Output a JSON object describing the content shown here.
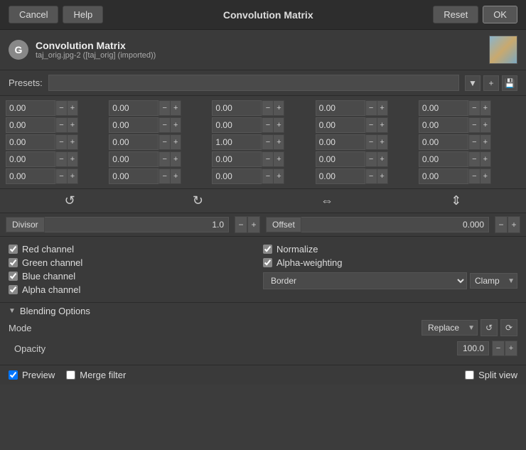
{
  "titlebar": {
    "cancel_label": "Cancel",
    "help_label": "Help",
    "title": "Convolution Matrix",
    "reset_label": "Reset",
    "ok_label": "OK"
  },
  "plugin": {
    "icon_letter": "G",
    "title": "Convolution Matrix",
    "subtitle": "taj_orig.jpg-2 ([taj_orig] (imported))"
  },
  "presets": {
    "label": "Presets:",
    "add_icon": "+",
    "remove_icon": "🗑"
  },
  "matrix": {
    "rows": [
      [
        "0.00",
        "0.00",
        "0.00",
        "0.00",
        "0.00"
      ],
      [
        "0.00",
        "0.00",
        "0.00",
        "0.00",
        "0.00"
      ],
      [
        "0.00",
        "0.00",
        "1.00",
        "0.00",
        "0.00"
      ],
      [
        "0.00",
        "0.00",
        "0.00",
        "0.00",
        "0.00"
      ],
      [
        "0.00",
        "0.00",
        "0.00",
        "0.00",
        "0.00"
      ]
    ]
  },
  "divisor": {
    "label": "Divisor",
    "value": "1.0"
  },
  "offset": {
    "label": "Offset",
    "value": "0.000"
  },
  "options": {
    "red_channel": "Red channel",
    "green_channel": "Green channel",
    "blue_channel": "Blue channel",
    "alpha_channel": "Alpha channel",
    "normalize": "Normalize",
    "alpha_weighting": "Alpha-weighting",
    "border_label": "Border",
    "clamp_label": "Clamp"
  },
  "blending": {
    "title": "Blending Options",
    "mode_label": "Mode",
    "mode_value": "Replace",
    "opacity_label": "Opacity",
    "opacity_value": "100.0"
  },
  "footer": {
    "preview_label": "Preview",
    "merge_filter_label": "Merge filter",
    "split_view_label": "Split view"
  },
  "colors": {
    "accent": "#5a9fd4",
    "bg_dark": "#2d2d2d",
    "bg_mid": "#3a3a3a",
    "bg_light": "#4a4a4a"
  }
}
